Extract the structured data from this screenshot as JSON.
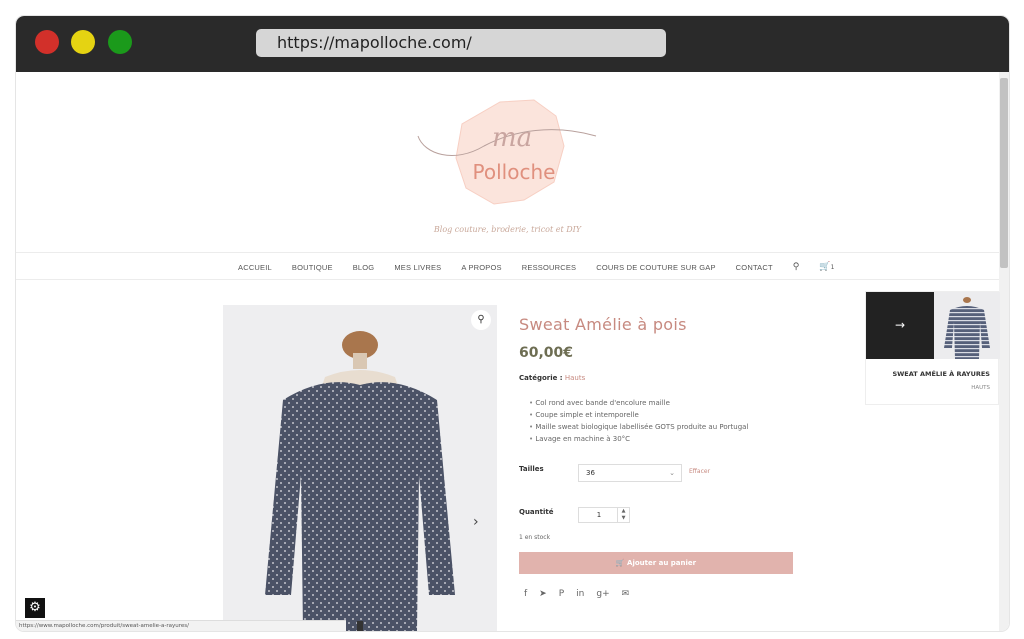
{
  "browser": {
    "url": "https://mapolloche.com/"
  },
  "site": {
    "logo_text_top": "ma",
    "logo_text_main": "Polloche",
    "tagline": "Blog couture, broderie, tricot et DIY"
  },
  "nav": {
    "items": [
      "ACCUEIL",
      "BOUTIQUE",
      "BLOG",
      "MES LIVRES",
      "A PROPOS",
      "RESSOURCES",
      "COURS DE COUTURE SUR GAP",
      "CONTACT"
    ],
    "cart_count": "1"
  },
  "product": {
    "title": "Sweat Amélie à pois",
    "price": "60,00€",
    "category_label": "Catégorie :",
    "category_value": "Hauts",
    "features": [
      "Col rond avec bande d'encolure maille",
      "Coupe simple et intemporelle",
      "Maille sweat biologique labellisée GOTS produite au Portugal",
      "Lavage en machine à 30°C"
    ],
    "sizes_label": "Tailles",
    "size_selected": "36",
    "clear_label": "Effacer",
    "quantity_label": "Quantité",
    "quantity_value": "1",
    "stock": "1 en stock",
    "add_to_cart": "Ajouter au panier"
  },
  "related": {
    "title": "SWEAT AMÉLIE À RAYURES",
    "category": "HAUTS"
  },
  "status_bar": {
    "url": "https://www.mapolloche.com/produit/sweat-amelie-a-rayures/"
  },
  "colors": {
    "accent": "#c78a80",
    "button": "#e1b3ad",
    "price": "#6d6d52"
  }
}
